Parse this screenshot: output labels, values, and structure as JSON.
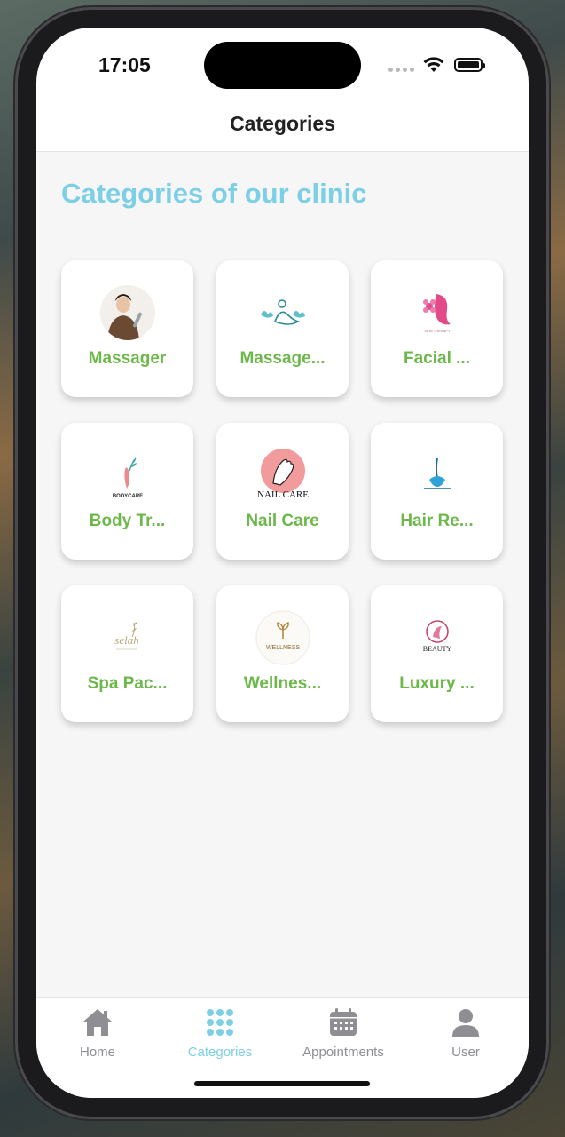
{
  "status_bar": {
    "time": "17:05"
  },
  "header": {
    "title": "Categories"
  },
  "main": {
    "section_title": "Categories of our clinic",
    "categories": [
      {
        "label": "Massager",
        "icon": "therapist-photo"
      },
      {
        "label": "Massage...",
        "icon": "massage-lotus-icon"
      },
      {
        "label": "Facial ...",
        "icon": "facial-flower-icon",
        "logo_text": "SKIN THERAPY"
      },
      {
        "label": "Body Tr...",
        "icon": "bodycare-hand-icon",
        "logo_text": "BODYCARE"
      },
      {
        "label": "Nail Care",
        "icon": "nail-care-logo",
        "logo_text": "NAIL CARE"
      },
      {
        "label": "Hair Re...",
        "icon": "hair-follicle-icon"
      },
      {
        "label": "Spa Pac...",
        "icon": "spa-selah-logo",
        "logo_text": "selah"
      },
      {
        "label": "Wellnes...",
        "icon": "wellness-logo",
        "logo_text": "WELLNESS"
      },
      {
        "label": "Luxury ...",
        "icon": "beauty-face-logo",
        "logo_text": "BEAUTY"
      }
    ]
  },
  "tab_bar": {
    "tabs": [
      {
        "label": "Home",
        "icon": "home-icon",
        "active": false
      },
      {
        "label": "Categories",
        "icon": "grid-dots-icon",
        "active": true
      },
      {
        "label": "Appointments",
        "icon": "calendar-icon",
        "active": false
      },
      {
        "label": "User",
        "icon": "user-icon",
        "active": false
      }
    ]
  },
  "colors": {
    "accent": "#7ccfe5",
    "label_green": "#6db84a",
    "inactive": "#8e8e93",
    "content_bg": "#f6f6f7"
  }
}
